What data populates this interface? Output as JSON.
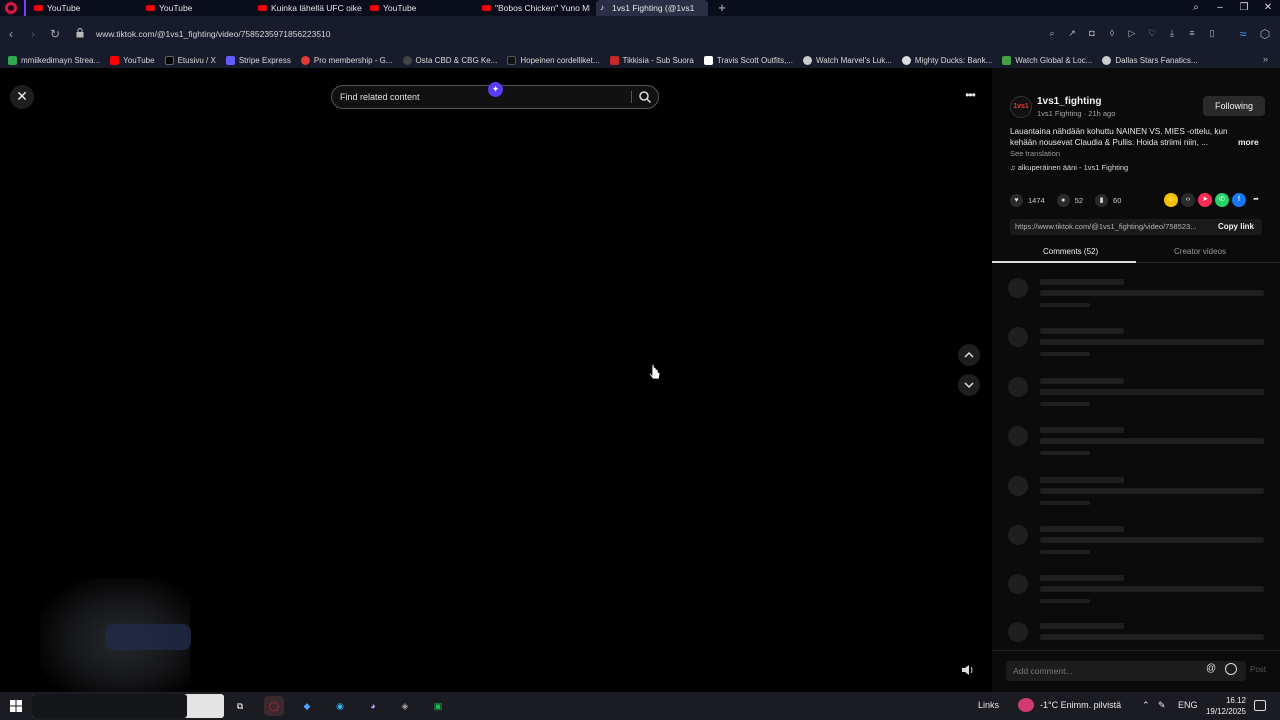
{
  "tabs": [
    {
      "title": "YouTube",
      "icon": "youtube-icon"
    },
    {
      "title": "YouTube",
      "icon": "youtube-icon"
    },
    {
      "title": "Kuinka lähellä UFC oikeast",
      "icon": "youtube-icon"
    },
    {
      "title": "YouTube",
      "icon": "youtube-icon"
    },
    {
      "title": "\"Bobos Chicken\" Yuno Mi",
      "icon": "youtube-icon"
    },
    {
      "title": "1vs1 Fighting (@1vs1",
      "icon": "tiktok-icon",
      "active": true
    }
  ],
  "address": {
    "url": "www.tiktok.com/@1vs1_fighting/video/7585235971856223510"
  },
  "bookmarks": [
    {
      "label": "mmiikedimayn Strea...",
      "color": "#2fa84f"
    },
    {
      "label": "YouTube",
      "color": "#ff0000"
    },
    {
      "label": "Etusivu / X",
      "color": "#000000"
    },
    {
      "label": "Stripe Express",
      "color": "#635bff"
    },
    {
      "label": "Pro membership - G...",
      "color": "#e53935"
    },
    {
      "label": "Osta CBD & CBG Ke...",
      "color": "#444444"
    },
    {
      "label": "Hopeinen cordelliket...",
      "color": "#111111"
    },
    {
      "label": "Tikkisia - Sub Suora",
      "color": "#c62828"
    },
    {
      "label": "Travis Scott Outfits,...",
      "color": "#ffffff"
    },
    {
      "label": "Watch Marvel's Luk...",
      "color": "#cccccc"
    },
    {
      "label": "Mighty Ducks: Bank...",
      "color": "#dddddd"
    },
    {
      "label": "Watch Global & Loc...",
      "color": "#43a047"
    },
    {
      "label": "Dallas Stars Fanatics...",
      "color": "#cccccc"
    }
  ],
  "search": {
    "placeholder": "Find related content"
  },
  "video": {
    "author": "1vs1_fighting",
    "author_sub": "1vs1 Fighting · 21h ago",
    "follow_label": "Following",
    "description": "Lauantaina nähdään kohuttu NAINEN VS. MIES -ottelu, kun kehään nousevat Claudia & Pullis. Hoida striimi niin, ...",
    "more_label": "more",
    "see_translation": "See translation",
    "music": "alkuperäinen ääni - 1vs1 Fighting",
    "likes": "1474",
    "comments": "52",
    "saves": "60",
    "link": "https://www.tiktok.com/@1vs1_fighting/video/758523...",
    "copy_label": "Copy link",
    "avatar_text": "1vs1"
  },
  "comment_tabs": {
    "comments": "Comments (52)",
    "creator": "Creator videos"
  },
  "comment_box": {
    "placeholder": "Add comment...",
    "post": "Post"
  },
  "taskbar": {
    "links": "Links",
    "weather": "-1°C  Enimm. pilvistä",
    "lang": "ENG",
    "time": "16.12",
    "date": "19/12/2025"
  },
  "colors": {
    "accent": "#5b3cf2",
    "opera_red": "#e0153b",
    "page_bg": "#000000"
  }
}
